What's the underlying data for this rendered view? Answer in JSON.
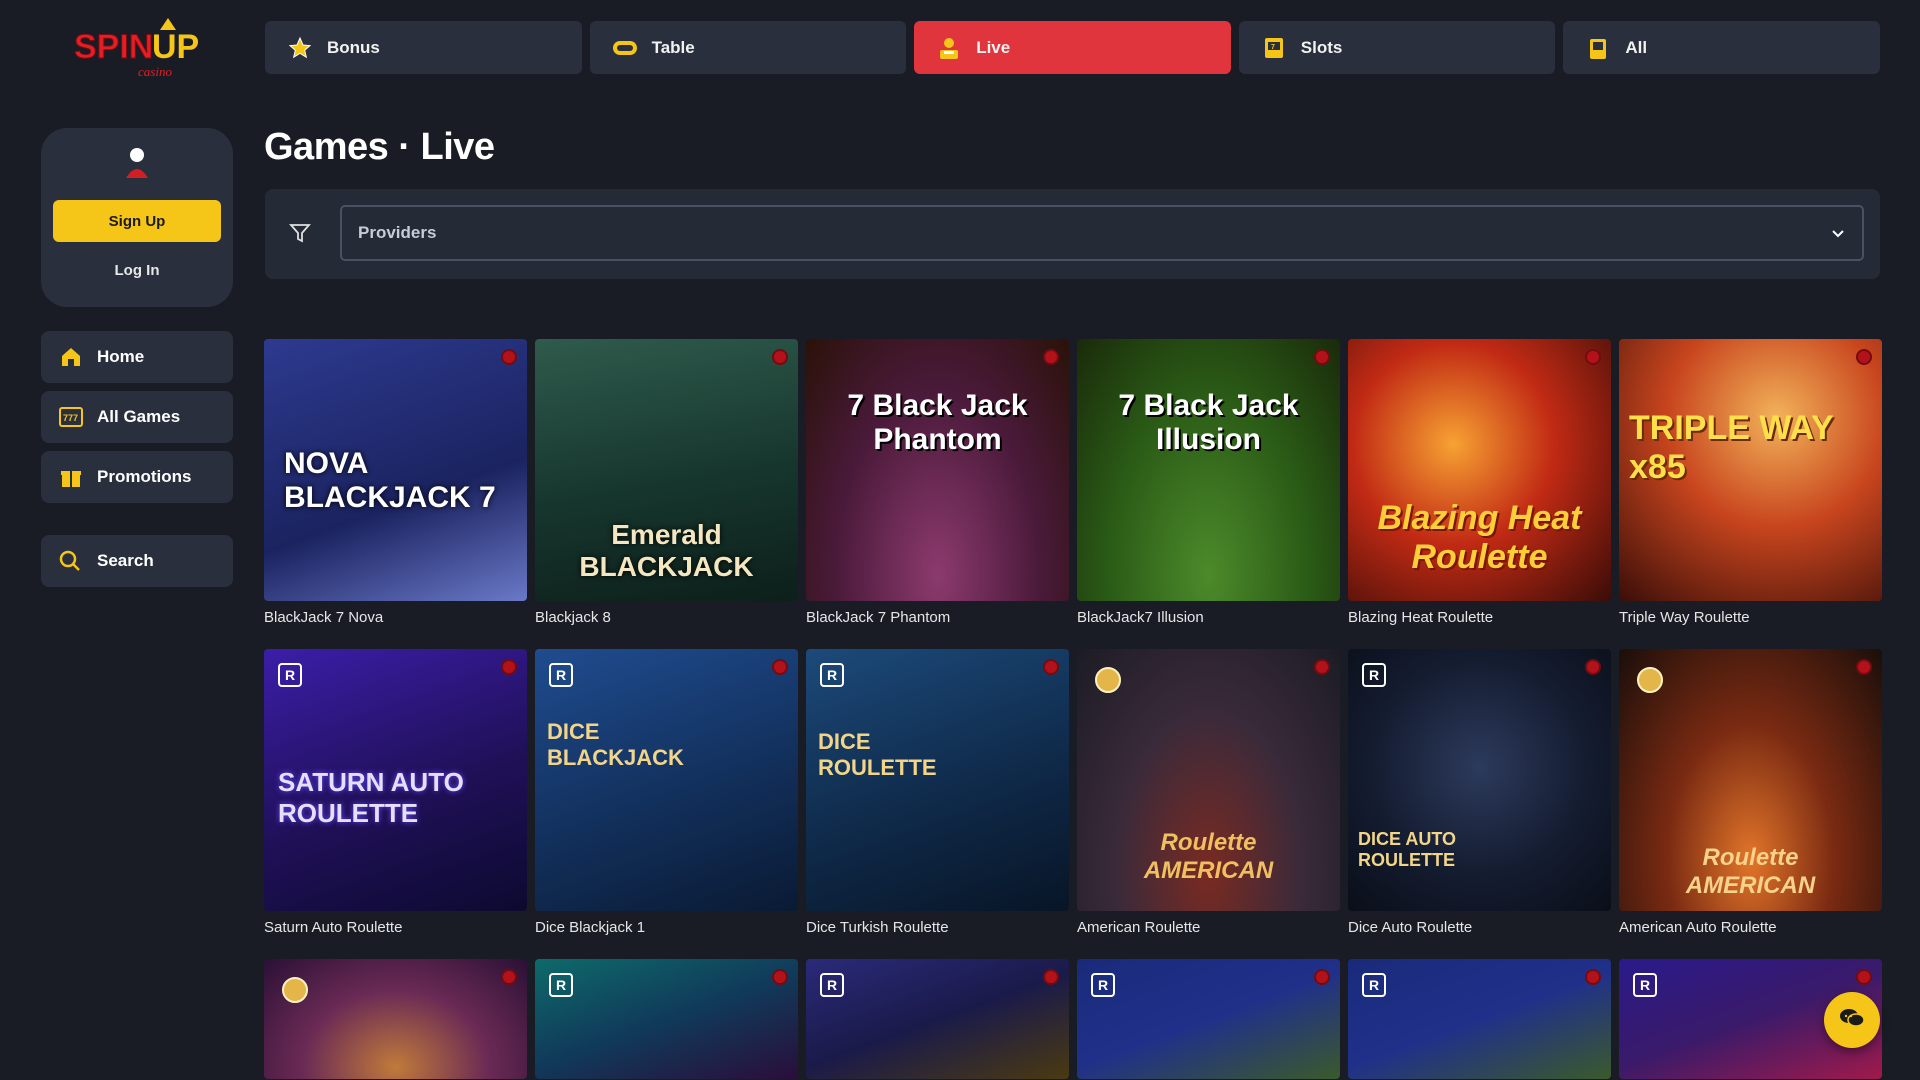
{
  "brand": {
    "logo_main_spin": "SPIN",
    "logo_main_up": "UP",
    "logo_sub": "casino"
  },
  "topnav": [
    {
      "label": "Bonus",
      "icon": "star-icon",
      "active": false
    },
    {
      "label": "Table",
      "icon": "chip-icon",
      "active": false
    },
    {
      "label": "Live",
      "icon": "dealer-icon",
      "active": true
    },
    {
      "label": "Slots",
      "icon": "slot-machine-icon",
      "active": false
    },
    {
      "label": "All",
      "icon": "cards-icon",
      "active": false
    }
  ],
  "user": {
    "signup_label": "Sign Up",
    "login_label": "Log In"
  },
  "sidebar": {
    "items": [
      {
        "label": "Home",
        "icon": "home-icon"
      },
      {
        "label": "All Games",
        "icon": "games-icon"
      },
      {
        "label": "Promotions",
        "icon": "gift-icon"
      }
    ],
    "search_label": "Search"
  },
  "page": {
    "title": "Games · Live"
  },
  "filter": {
    "providers_placeholder": "Providers"
  },
  "games": [
    {
      "name": "BlackJack 7 Nova",
      "art": "NOVA BLACKJACK 7"
    },
    {
      "name": "Blackjack 8",
      "art": "Emerald BLACKJACK"
    },
    {
      "name": "BlackJack 7 Phantom",
      "art": "7 Black Jack Phantom"
    },
    {
      "name": "BlackJack7 Illusion",
      "art": "7 Black Jack Illusion"
    },
    {
      "name": "Blazing Heat Roulette",
      "art": "Blazing Heat Roulette"
    },
    {
      "name": "Triple Way Roulette",
      "art": "TRIPLE WAY x85"
    },
    {
      "name": "Saturn Auto Roulette",
      "art": "SATURN AUTO ROULETTE"
    },
    {
      "name": "Dice Blackjack 1",
      "art": "DICE BLACKJACK"
    },
    {
      "name": "Dice Turkish Roulette",
      "art": "DICE ROULETTE"
    },
    {
      "name": "American Roulette",
      "art": "Roulette AMERICAN"
    },
    {
      "name": "Dice Auto Roulette",
      "art": "DICE AUTO ROULETTE"
    },
    {
      "name": "American Auto Roulette",
      "art": "Roulette AMERICAN"
    },
    {
      "name": "",
      "art": ""
    },
    {
      "name": "",
      "art": ""
    },
    {
      "name": "",
      "art": ""
    },
    {
      "name": "",
      "art": ""
    },
    {
      "name": "",
      "art": ""
    },
    {
      "name": "",
      "art": ""
    }
  ],
  "colors": {
    "background": "#191c25",
    "panel": "#2a2f3d",
    "accent_red": "#e0353d",
    "accent_yellow": "#f5c518"
  }
}
